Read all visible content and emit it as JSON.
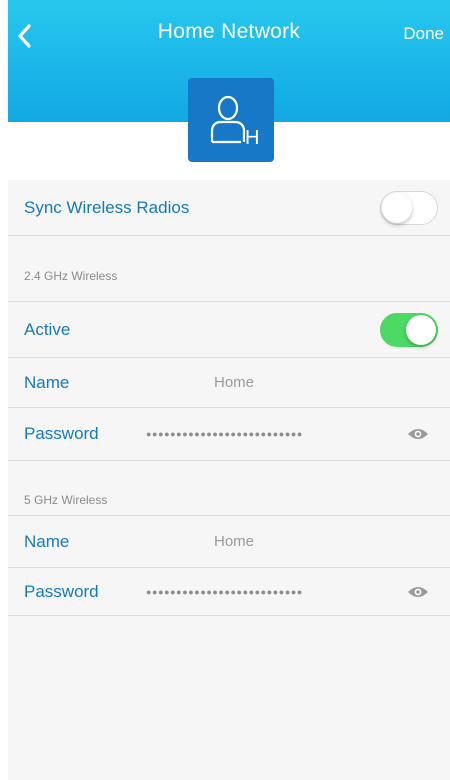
{
  "header": {
    "title": "Home Network",
    "done_label": "Done",
    "back_icon": "chevron-left-icon",
    "avatar_icon": "user-home-icon",
    "avatar_letter": "H",
    "color": "#1cb6ea"
  },
  "sync": {
    "label": "Sync Wireless Radios",
    "enabled": false
  },
  "band_24": {
    "section_label": "2.4 GHz Wireless",
    "active_label": "Active",
    "active": true,
    "name_label": "Name",
    "name_value": "Home",
    "password_label": "Password",
    "password_mask": "●●●●●●●●●●●●●●●●●●●●●●●●●●",
    "eye_icon": "eye-icon"
  },
  "band_5": {
    "section_label": "5 GHz Wireless",
    "name_label": "Name",
    "name_value": "Home",
    "password_label": "Password",
    "password_mask": "●●●●●●●●●●●●●●●●●●●●●●●●●●",
    "eye_icon": "eye-icon"
  },
  "colors": {
    "accent": "#1579bf",
    "toggle_on": "#4cd964",
    "avatar_bg": "#1678c6"
  }
}
